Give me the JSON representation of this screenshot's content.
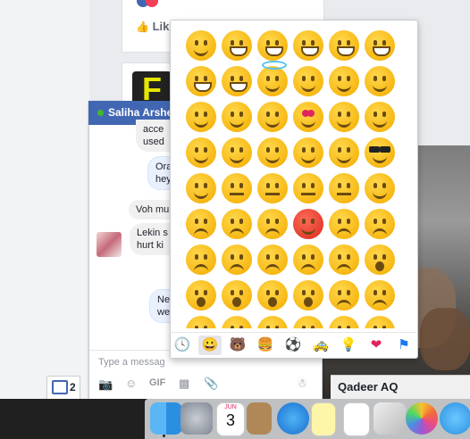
{
  "feed": {
    "like_label": "Lik"
  },
  "chat": {
    "contact_name": "Saliha Arshe",
    "messages": [
      {
        "text": "acce",
        "from": "them"
      },
      {
        "text": "used",
        "from": "them"
      },
      {
        "text": "Ora",
        "from": "me"
      },
      {
        "text": "hey",
        "from": "me"
      },
      {
        "text": "Voh mu",
        "from": "them"
      },
      {
        "text": "Lekin s",
        "from": "them"
      },
      {
        "text": "hurt ki",
        "from": "them"
      },
      {
        "text": "Ne",
        "from": "me"
      },
      {
        "text": "we",
        "from": "me"
      }
    ],
    "input_placeholder": "Type a messag",
    "gif_label": "GIF",
    "unread_count": "2"
  },
  "emoji_panel": {
    "emojis": [
      "grinning",
      "grimacing",
      "grin",
      "joy",
      "smiley",
      "smile",
      "sweat-smile",
      "laughing",
      "innocent",
      "wink",
      "blush",
      "slightly-smiling",
      "relaxed",
      "yum",
      "relieved",
      "heart-eyes",
      "kissing-heart",
      "kissing",
      "kissing-smiling-eyes",
      "kissing-closed-eyes",
      "stuck-out-tongue-winking-eye",
      "stuck-out-tongue-closed-eyes",
      "stuck-out-tongue",
      "sunglasses",
      "smirk",
      "no-mouth",
      "neutral-face",
      "expressionless",
      "unamused",
      "rolling-eyes",
      "disappointed",
      "worried",
      "angry",
      "rage",
      "pensive",
      "confused",
      "persevere",
      "confounded",
      "tired-face",
      "weary",
      "triumph",
      "open-mouth",
      "scream",
      "fearful",
      "cold-sweat",
      "hushed",
      "frowning",
      "anguished",
      "cry",
      "disappointed-relieved",
      "sob",
      "sleepy",
      "dizzy-face",
      "astonished"
    ],
    "tabs": [
      "recent",
      "people",
      "nature",
      "food",
      "activity",
      "travel",
      "objects",
      "symbols",
      "flags"
    ],
    "selected_tab": "people"
  },
  "photo": {
    "caption": "Qadeer AQ"
  },
  "dock": {
    "calendar_month": "JUN",
    "calendar_day": "3",
    "apps": [
      "finder",
      "launchpad",
      "calendar",
      "contacts",
      "safari",
      "notes",
      "reminders",
      "preview",
      "photos",
      "messages"
    ]
  }
}
